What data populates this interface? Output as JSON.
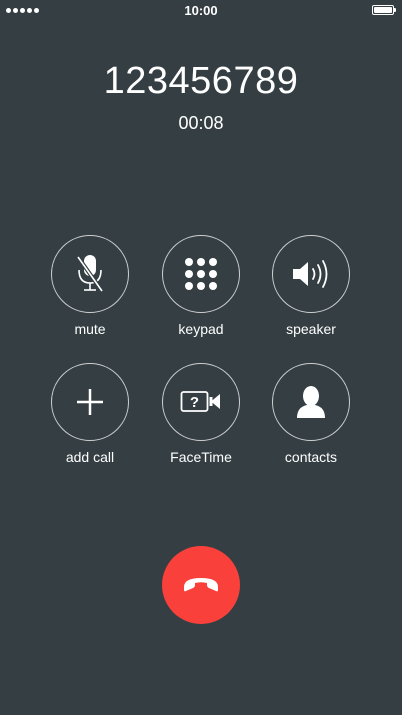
{
  "status_bar": {
    "time": "10:00",
    "signal_icon": "signal-dots-icon",
    "battery_icon": "battery-full-icon"
  },
  "call": {
    "number": "123456789",
    "duration": "00:08"
  },
  "controls": [
    {
      "label": "mute",
      "icon": "microphone-muted-icon"
    },
    {
      "label": "keypad",
      "icon": "keypad-icon"
    },
    {
      "label": "speaker",
      "icon": "speaker-icon"
    },
    {
      "label": "add call",
      "icon": "plus-icon"
    },
    {
      "label": "FaceTime",
      "icon": "facetime-icon"
    },
    {
      "label": "contacts",
      "icon": "contact-silhouette-icon"
    }
  ],
  "end_call": {
    "icon": "phone-hangup-icon",
    "color": "#f9403a"
  },
  "colors": {
    "background": "#353f43",
    "end_call": "#f9403a"
  }
}
